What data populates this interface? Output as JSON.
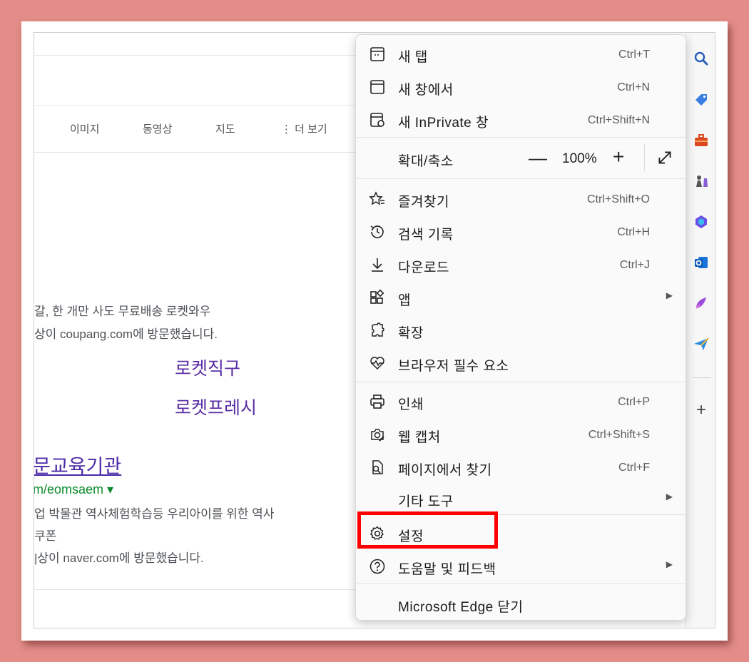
{
  "background": {
    "tabs": [
      {
        "label": "이미지"
      },
      {
        "label": "동영상"
      },
      {
        "label": "지도"
      },
      {
        "label": "⋮ 더 보기"
      }
    ],
    "result1_snippet_line1": "갈, 한 개만 사도 무료배송 로켓와우",
    "result1_snippet_line2": "상이 coupang.com에 방문했습니다.",
    "sitelinks": [
      "로켓직구",
      "로켓프레시"
    ],
    "result2_title": "문교육기관",
    "result2_url": "m/eomsaem ▾",
    "result2_snippet_line1": "업 박물관 역사체험학습등 우리아이를 위한 역사",
    "result2_snippet_line2": "쿠폰",
    "result2_snippet_line3": "|상이 naver.com에 방문했습니다."
  },
  "menu": {
    "new_tab": {
      "label": "새 탭",
      "shortcut": "Ctrl+T"
    },
    "new_window": {
      "label": "새 창에서",
      "shortcut": "Ctrl+N"
    },
    "inprivate": {
      "label": "새 InPrivate 창",
      "shortcut": "Ctrl+Shift+N"
    },
    "zoom": {
      "label": "확대/축소",
      "minus": "—",
      "value": "100%",
      "plus": "+"
    },
    "favorites": {
      "label": "즐겨찾기",
      "shortcut": "Ctrl+Shift+O"
    },
    "history": {
      "label": "검색 기록",
      "shortcut": "Ctrl+H"
    },
    "downloads": {
      "label": "다운로드",
      "shortcut": "Ctrl+J"
    },
    "apps": {
      "label": "앱"
    },
    "extensions": {
      "label": "확장"
    },
    "essentials": {
      "label": "브라우저 필수 요소"
    },
    "print": {
      "label": "인쇄",
      "shortcut": "Ctrl+P"
    },
    "web_capture": {
      "label": "웹 캡처",
      "shortcut": "Ctrl+Shift+S"
    },
    "find": {
      "label": "페이지에서 찾기",
      "shortcut": "Ctrl+F"
    },
    "more_tools": {
      "label": "기타 도구"
    },
    "settings": {
      "label": "설정"
    },
    "help": {
      "label": "도움말 및 피드백"
    },
    "close": {
      "label": "Microsoft Edge 닫기"
    }
  },
  "sidebar": {
    "icons": [
      "search-icon",
      "shopping-tag-icon",
      "tools-briefcase-icon",
      "games-icon",
      "copilot-icon",
      "outlook-icon",
      "designer-icon",
      "send-icon",
      "add-icon"
    ],
    "add_label": "+"
  },
  "colors": {
    "highlight": "#ff0000",
    "border_bg": "#e48d88",
    "link": "#5a2ea6",
    "url": "#0a8a2a"
  }
}
